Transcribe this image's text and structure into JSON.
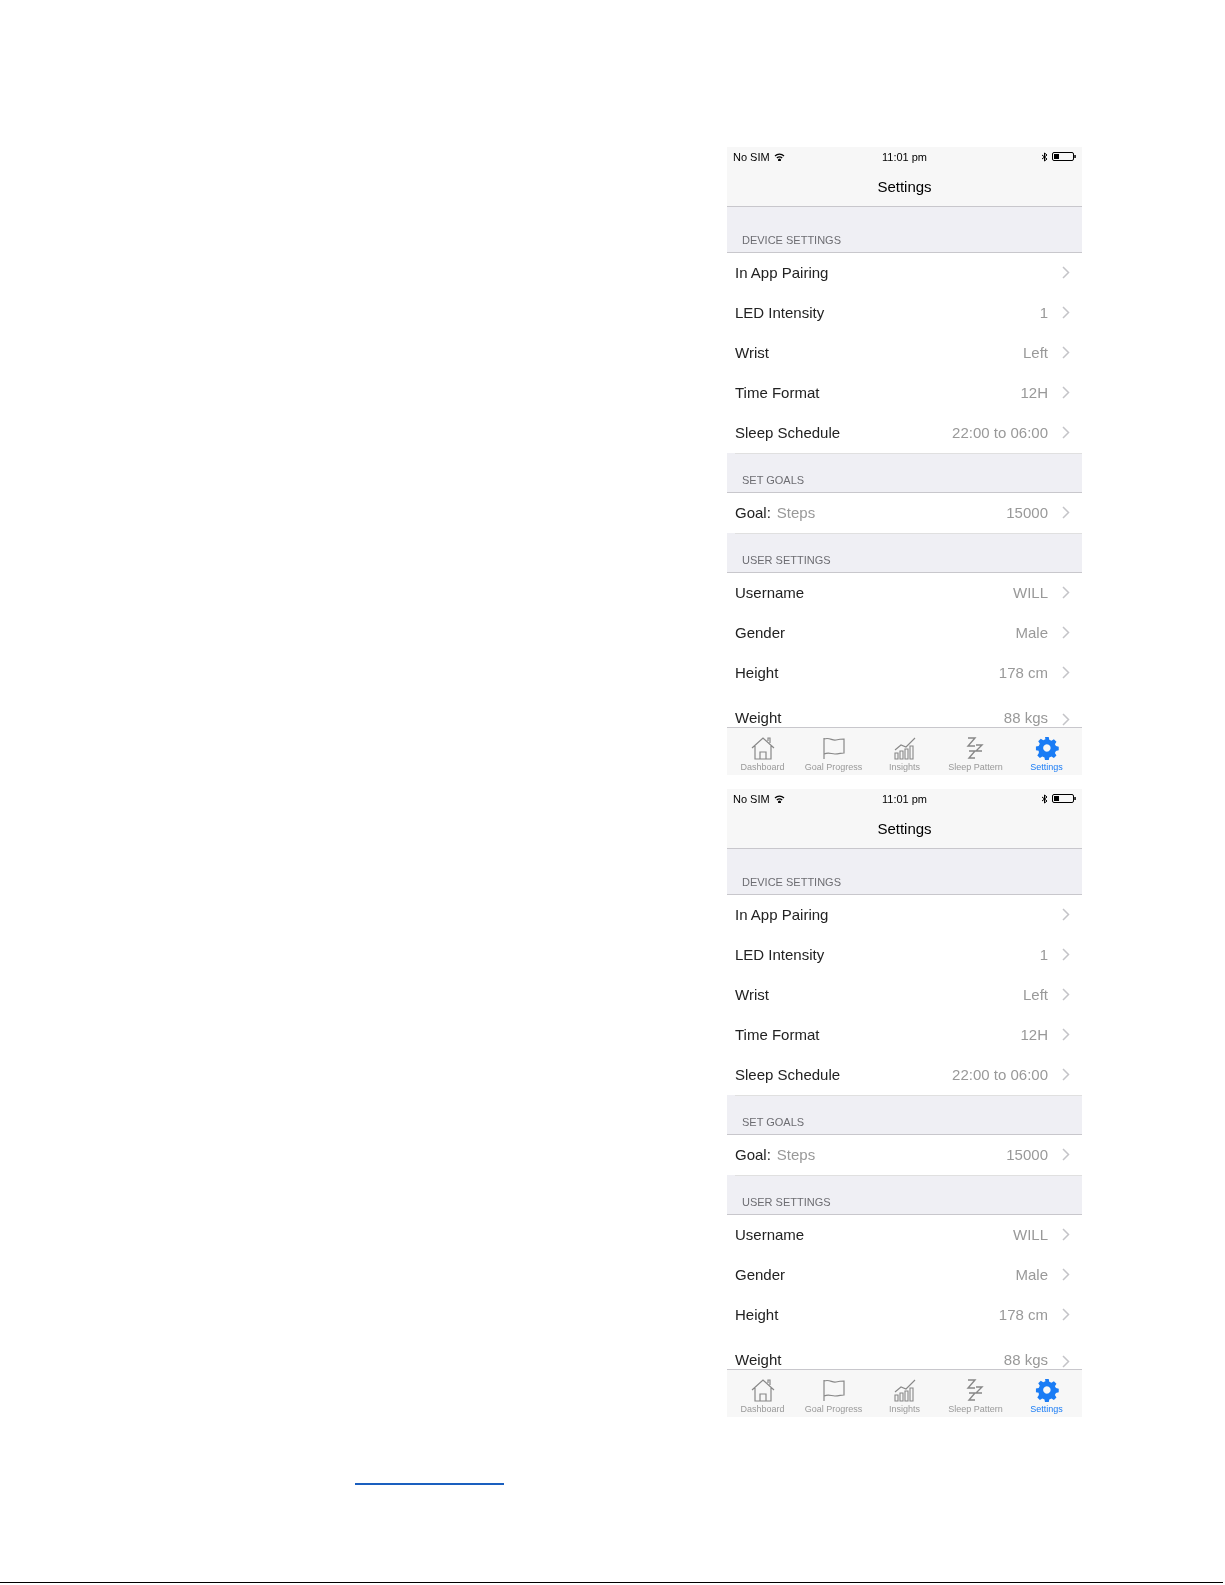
{
  "phones": [
    {
      "status_bar": {
        "carrier": "No SIM",
        "time": "11:01 pm"
      },
      "title": "Settings",
      "sections": [
        {
          "header": "DEVICE SETTINGS",
          "rows": [
            {
              "label": "In App Pairing"
            },
            {
              "label": "LED Intensity",
              "value": "1"
            },
            {
              "label": "Wrist",
              "value": "Left"
            },
            {
              "label": "Time Format",
              "value": "12H"
            },
            {
              "label": "Sleep Schedule",
              "value": "22:00 to 06:00"
            }
          ]
        },
        {
          "header": "SET GOALS",
          "rows": [
            {
              "label": "Goal:",
              "detail": "Steps",
              "value": "15000"
            }
          ]
        },
        {
          "header": "USER SETTINGS",
          "rows": [
            {
              "label": "Username",
              "value": "WILL"
            },
            {
              "label": "Gender",
              "value": "Male"
            },
            {
              "label": "Height",
              "value": "178 cm"
            },
            {
              "label": "Weight",
              "value": "88 kgs"
            }
          ]
        }
      ],
      "tabs": [
        {
          "kind": "home",
          "label": "Dashboard",
          "selected": false
        },
        {
          "kind": "flag",
          "label": "Goal Progress",
          "selected": false
        },
        {
          "kind": "chart",
          "label": "Insights",
          "selected": false
        },
        {
          "kind": "sleep",
          "label": "Sleep Pattern",
          "selected": false
        },
        {
          "kind": "gear",
          "label": "Settings",
          "selected": true
        }
      ]
    },
    {
      "status_bar": {
        "carrier": "No SIM",
        "time": "11:01 pm"
      },
      "title": "Settings",
      "sections": [
        {
          "header": "DEVICE SETTINGS",
          "rows": [
            {
              "label": "In App Pairing"
            },
            {
              "label": "LED Intensity",
              "value": "1"
            },
            {
              "label": "Wrist",
              "value": "Left"
            },
            {
              "label": "Time Format",
              "value": "12H"
            },
            {
              "label": "Sleep Schedule",
              "value": "22:00 to 06:00"
            }
          ]
        },
        {
          "header": "SET GOALS",
          "rows": [
            {
              "label": "Goal:",
              "detail": "Steps",
              "value": "15000"
            }
          ]
        },
        {
          "header": "USER SETTINGS",
          "rows": [
            {
              "label": "Username",
              "value": "WILL"
            },
            {
              "label": "Gender",
              "value": "Male"
            },
            {
              "label": "Height",
              "value": "178 cm"
            },
            {
              "label": "Weight",
              "value": "88 kgs"
            }
          ]
        }
      ],
      "tabs": [
        {
          "kind": "home",
          "label": "Dashboard",
          "selected": false
        },
        {
          "kind": "flag",
          "label": "Goal Progress",
          "selected": false
        },
        {
          "kind": "chart",
          "label": "Insights",
          "selected": false
        },
        {
          "kind": "sleep",
          "label": "Sleep Pattern",
          "selected": false
        },
        {
          "kind": "gear",
          "label": "Settings",
          "selected": true
        }
      ]
    }
  ]
}
